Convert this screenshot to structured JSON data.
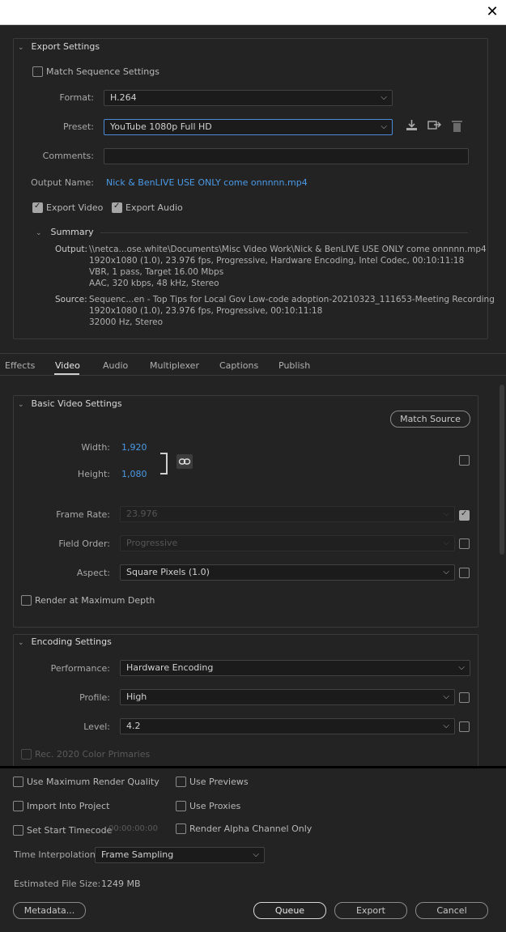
{
  "window": {
    "close_glyph": "✕"
  },
  "export_settings": {
    "title": "Export Settings",
    "match_sequence": "Match Sequence Settings",
    "format_label": "Format:",
    "format_value": "H.264",
    "preset_label": "Preset:",
    "preset_value": "YouTube 1080p Full HD",
    "comments_label": "Comments:",
    "comments_value": "",
    "output_name_label": "Output Name:",
    "output_name_value": "Nick & BenLIVE USE ONLY come onnnnn.mp4",
    "export_video": "Export Video",
    "export_audio": "Export Audio",
    "export_video_checked": true,
    "export_audio_checked": true
  },
  "summary": {
    "title": "Summary",
    "output_label": "Output:",
    "output_lines": [
      "\\\\netca...ose.white\\Documents\\Misc Video Work\\Nick & BenLIVE USE ONLY come onnnnn.mp4",
      "1920x1080 (1.0), 23.976 fps, Progressive, Hardware Encoding, Intel Codec, 00:10:11:18",
      "VBR, 1 pass, Target 16.00 Mbps",
      "AAC, 320 kbps, 48 kHz, Stereo"
    ],
    "source_label": "Source:",
    "source_lines": [
      "Sequenc...en - Top Tips for Local Gov Low-code adoption-20210323_111653-Meeting Recording",
      "1920x1080 (1.0), 23.976 fps, Progressive, 00:10:11:18",
      "32000 Hz, Stereo"
    ]
  },
  "tabs": [
    "Effects",
    "Video",
    "Audio",
    "Multiplexer",
    "Captions",
    "Publish"
  ],
  "active_tab": "Video",
  "basic_video": {
    "title": "Basic Video Settings",
    "match_source": "Match Source",
    "width_label": "Width:",
    "width_value": "1,920",
    "height_label": "Height:",
    "height_value": "1,080",
    "frame_rate_label": "Frame Rate:",
    "frame_rate_value": "23.976",
    "field_order_label": "Field Order:",
    "field_order_value": "Progressive",
    "aspect_label": "Aspect:",
    "aspect_value": "Square Pixels (1.0)",
    "render_max_depth": "Render at Maximum Depth"
  },
  "encoding": {
    "title": "Encoding Settings",
    "performance_label": "Performance:",
    "performance_value": "Hardware Encoding",
    "profile_label": "Profile:",
    "profile_value": "High",
    "level_label": "Level:",
    "level_value": "4.2",
    "rec2020": "Rec. 2020 Color Primaries"
  },
  "bottom": {
    "max_render_quality": "Use Maximum Render Quality",
    "use_previews": "Use Previews",
    "import_into_project": "Import Into Project",
    "use_proxies": "Use Proxies",
    "set_start_timecode": "Set Start Timecode",
    "timecode_value": "00:00:00:00",
    "render_alpha": "Render Alpha Channel Only",
    "time_interp_label": "Time Interpolation:",
    "time_interp_value": "Frame Sampling",
    "est_size_label": "Estimated File Size:",
    "est_size_value": "1249 MB",
    "metadata_btn": "Metadata...",
    "queue_btn": "Queue",
    "export_btn": "Export",
    "cancel_btn": "Cancel"
  },
  "icons": {
    "save_preset": "download-icon",
    "import_preset": "import-icon",
    "delete_preset": "trash-icon",
    "link": "chain-link-icon"
  },
  "colors": {
    "accent": "#4b9ae6",
    "background": "#232323"
  }
}
